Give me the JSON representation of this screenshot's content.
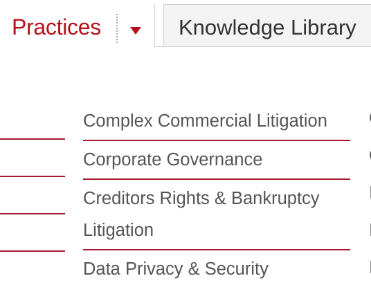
{
  "tabs": {
    "practices_label": "Practices",
    "knowledge_label": "Knowledge Library"
  },
  "icons": {
    "dropdown": "caret-down-icon"
  },
  "colors": {
    "accent": "#b5121b",
    "divider": "#a6192e",
    "text": "#555555"
  },
  "practices": {
    "main_items": [
      "Complex Commercial Litigation",
      "Corporate Governance",
      "Creditors Rights & Bankruptcy Litigation",
      "Data Privacy & Security"
    ],
    "right_items_partial": [
      "C",
      "C",
      "I",
      "I",
      "I"
    ]
  }
}
